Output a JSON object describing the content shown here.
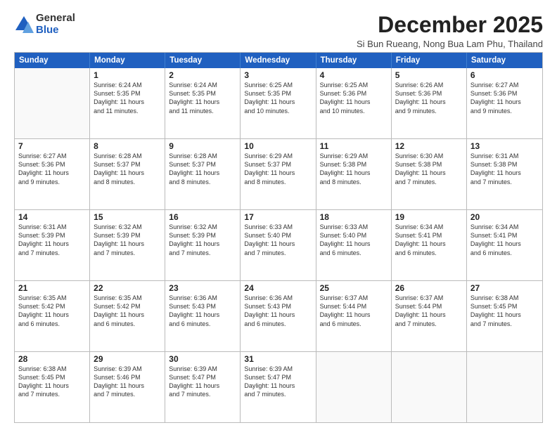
{
  "logo": {
    "general": "General",
    "blue": "Blue"
  },
  "title": "December 2025",
  "location": "Si Bun Rueang, Nong Bua Lam Phu, Thailand",
  "header_days": [
    "Sunday",
    "Monday",
    "Tuesday",
    "Wednesday",
    "Thursday",
    "Friday",
    "Saturday"
  ],
  "weeks": [
    [
      {
        "day": "",
        "info": ""
      },
      {
        "day": "1",
        "info": "Sunrise: 6:24 AM\nSunset: 5:35 PM\nDaylight: 11 hours\nand 11 minutes."
      },
      {
        "day": "2",
        "info": "Sunrise: 6:24 AM\nSunset: 5:35 PM\nDaylight: 11 hours\nand 11 minutes."
      },
      {
        "day": "3",
        "info": "Sunrise: 6:25 AM\nSunset: 5:35 PM\nDaylight: 11 hours\nand 10 minutes."
      },
      {
        "day": "4",
        "info": "Sunrise: 6:25 AM\nSunset: 5:36 PM\nDaylight: 11 hours\nand 10 minutes."
      },
      {
        "day": "5",
        "info": "Sunrise: 6:26 AM\nSunset: 5:36 PM\nDaylight: 11 hours\nand 9 minutes."
      },
      {
        "day": "6",
        "info": "Sunrise: 6:27 AM\nSunset: 5:36 PM\nDaylight: 11 hours\nand 9 minutes."
      }
    ],
    [
      {
        "day": "7",
        "info": "Sunrise: 6:27 AM\nSunset: 5:36 PM\nDaylight: 11 hours\nand 9 minutes."
      },
      {
        "day": "8",
        "info": "Sunrise: 6:28 AM\nSunset: 5:37 PM\nDaylight: 11 hours\nand 8 minutes."
      },
      {
        "day": "9",
        "info": "Sunrise: 6:28 AM\nSunset: 5:37 PM\nDaylight: 11 hours\nand 8 minutes."
      },
      {
        "day": "10",
        "info": "Sunrise: 6:29 AM\nSunset: 5:37 PM\nDaylight: 11 hours\nand 8 minutes."
      },
      {
        "day": "11",
        "info": "Sunrise: 6:29 AM\nSunset: 5:38 PM\nDaylight: 11 hours\nand 8 minutes."
      },
      {
        "day": "12",
        "info": "Sunrise: 6:30 AM\nSunset: 5:38 PM\nDaylight: 11 hours\nand 7 minutes."
      },
      {
        "day": "13",
        "info": "Sunrise: 6:31 AM\nSunset: 5:38 PM\nDaylight: 11 hours\nand 7 minutes."
      }
    ],
    [
      {
        "day": "14",
        "info": "Sunrise: 6:31 AM\nSunset: 5:39 PM\nDaylight: 11 hours\nand 7 minutes."
      },
      {
        "day": "15",
        "info": "Sunrise: 6:32 AM\nSunset: 5:39 PM\nDaylight: 11 hours\nand 7 minutes."
      },
      {
        "day": "16",
        "info": "Sunrise: 6:32 AM\nSunset: 5:39 PM\nDaylight: 11 hours\nand 7 minutes."
      },
      {
        "day": "17",
        "info": "Sunrise: 6:33 AM\nSunset: 5:40 PM\nDaylight: 11 hours\nand 7 minutes."
      },
      {
        "day": "18",
        "info": "Sunrise: 6:33 AM\nSunset: 5:40 PM\nDaylight: 11 hours\nand 6 minutes."
      },
      {
        "day": "19",
        "info": "Sunrise: 6:34 AM\nSunset: 5:41 PM\nDaylight: 11 hours\nand 6 minutes."
      },
      {
        "day": "20",
        "info": "Sunrise: 6:34 AM\nSunset: 5:41 PM\nDaylight: 11 hours\nand 6 minutes."
      }
    ],
    [
      {
        "day": "21",
        "info": "Sunrise: 6:35 AM\nSunset: 5:42 PM\nDaylight: 11 hours\nand 6 minutes."
      },
      {
        "day": "22",
        "info": "Sunrise: 6:35 AM\nSunset: 5:42 PM\nDaylight: 11 hours\nand 6 minutes."
      },
      {
        "day": "23",
        "info": "Sunrise: 6:36 AM\nSunset: 5:43 PM\nDaylight: 11 hours\nand 6 minutes."
      },
      {
        "day": "24",
        "info": "Sunrise: 6:36 AM\nSunset: 5:43 PM\nDaylight: 11 hours\nand 6 minutes."
      },
      {
        "day": "25",
        "info": "Sunrise: 6:37 AM\nSunset: 5:44 PM\nDaylight: 11 hours\nand 6 minutes."
      },
      {
        "day": "26",
        "info": "Sunrise: 6:37 AM\nSunset: 5:44 PM\nDaylight: 11 hours\nand 7 minutes."
      },
      {
        "day": "27",
        "info": "Sunrise: 6:38 AM\nSunset: 5:45 PM\nDaylight: 11 hours\nand 7 minutes."
      }
    ],
    [
      {
        "day": "28",
        "info": "Sunrise: 6:38 AM\nSunset: 5:45 PM\nDaylight: 11 hours\nand 7 minutes."
      },
      {
        "day": "29",
        "info": "Sunrise: 6:39 AM\nSunset: 5:46 PM\nDaylight: 11 hours\nand 7 minutes."
      },
      {
        "day": "30",
        "info": "Sunrise: 6:39 AM\nSunset: 5:47 PM\nDaylight: 11 hours\nand 7 minutes."
      },
      {
        "day": "31",
        "info": "Sunrise: 6:39 AM\nSunset: 5:47 PM\nDaylight: 11 hours\nand 7 minutes."
      },
      {
        "day": "",
        "info": ""
      },
      {
        "day": "",
        "info": ""
      },
      {
        "day": "",
        "info": ""
      }
    ]
  ]
}
